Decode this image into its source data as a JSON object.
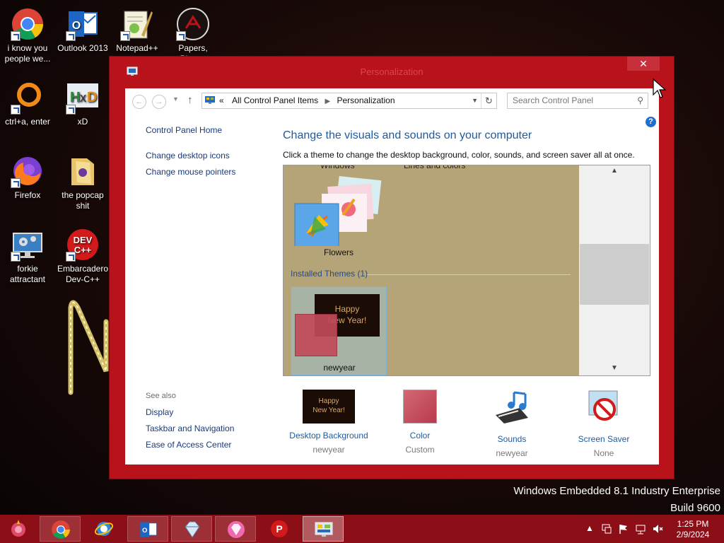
{
  "desktop": {
    "icons": [
      {
        "label": "i know you people we..."
      },
      {
        "label": "Outlook 2013"
      },
      {
        "label": "Notepad++"
      },
      {
        "label": "Papers, Please"
      },
      {
        "label": "ctrl+a, enter"
      },
      {
        "label": "xD"
      },
      {
        "label": "Firefox"
      },
      {
        "label": "the popcap shit"
      },
      {
        "label": "forkie attractant"
      },
      {
        "label": "Embarcadero Dev-C++"
      }
    ]
  },
  "window": {
    "title": "Personalization",
    "close_glyph": "✕",
    "address": {
      "prefix": "«",
      "crumb1": "All Control Panel Items",
      "crumb2": "Personalization"
    },
    "search": {
      "placeholder": "Search Control Panel"
    },
    "left_pane": {
      "home": "Control Panel Home",
      "links": [
        "Change desktop icons",
        "Change mouse pointers"
      ],
      "see_also_title": "See also",
      "see_also": [
        "Display",
        "Taskbar and Navigation",
        "Ease of Access Center"
      ]
    },
    "main": {
      "title": "Change the visuals and sounds on your computer",
      "description": "Click a theme to change the desktop background, color, sounds, and screen saver all at once.",
      "cut_labels": [
        "Windows",
        "Lines and colors"
      ],
      "themes": [
        {
          "name": "Flowers"
        }
      ],
      "installed_group": "Installed Themes (1)",
      "installed": [
        {
          "name": "newyear",
          "thumb_text_line1": "Happy",
          "thumb_text_line2": "New Year!"
        }
      ]
    },
    "bottom": [
      {
        "label": "Desktop Background",
        "value": "newyear",
        "thumb_text_line1": "Happy",
        "thumb_text_line2": "New Year!"
      },
      {
        "label": "Color",
        "value": "Custom"
      },
      {
        "label": "Sounds",
        "value": "newyear"
      },
      {
        "label": "Screen Saver",
        "value": "None"
      }
    ]
  },
  "watermark": {
    "line1": "Windows Embedded 8.1 Industry Enterprise",
    "line2": "Build 9600"
  },
  "taskbar": {
    "time": "1:25 PM",
    "date": "2/9/2024",
    "tray_chevron": "▲"
  },
  "colors": {
    "window_frame": "#b8121a",
    "taskbar": "#8c0e16",
    "link_blue": "#1e5a9e",
    "theme_bg": "#b4a478"
  }
}
